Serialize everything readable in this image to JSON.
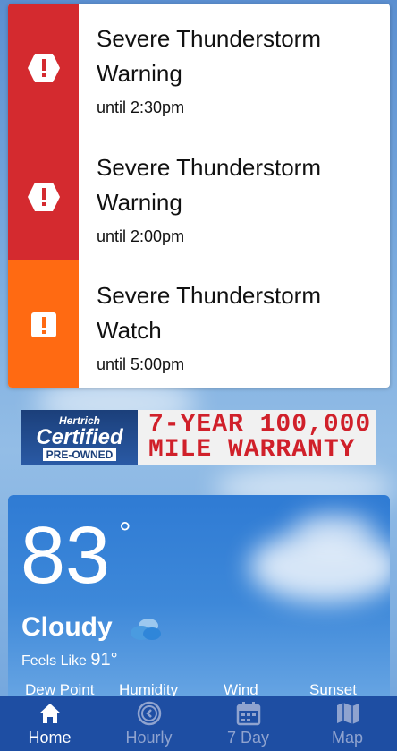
{
  "alerts": [
    {
      "title_line1": "Severe Thunderstorm",
      "title_line2": "Warning",
      "until": "until 2:30pm",
      "color": "#d42a2f",
      "icon": "warning-hexagon-icon"
    },
    {
      "title_line1": "Severe Thunderstorm",
      "title_line2": "Warning",
      "until": "until 2:00pm",
      "color": "#d42a2f",
      "icon": "warning-hexagon-icon"
    },
    {
      "title_line1": "Severe Thunderstorm",
      "title_line2": "Watch",
      "until": "until 5:00pm",
      "color": "#ff6a12",
      "icon": "exclamation-square-icon"
    }
  ],
  "ad": {
    "brand": "Hertrich",
    "certified": "Certified",
    "pre_owned": "PRE-OWNED",
    "line1": "7-YEAR 100,000",
    "line2": "MILE WARRANTY"
  },
  "current": {
    "temperature": "83",
    "degree_symbol": "°",
    "condition": "Cloudy",
    "feels_like_label": "Feels Like",
    "feels_like_value": "91°",
    "metric_labels": [
      "Dew Point",
      "Humidity",
      "Wind",
      "Sunset"
    ]
  },
  "nav": {
    "tabs": [
      {
        "label": "Home",
        "icon": "home-icon",
        "active": true
      },
      {
        "label": "Hourly",
        "icon": "clock-icon",
        "active": false
      },
      {
        "label": "7 Day",
        "icon": "calendar-icon",
        "active": false
      },
      {
        "label": "Map",
        "icon": "map-icon",
        "active": false
      }
    ]
  },
  "colors": {
    "accent_red": "#d42a2f",
    "accent_orange": "#ff6a12",
    "nav_bg": "#1e4ea3"
  }
}
